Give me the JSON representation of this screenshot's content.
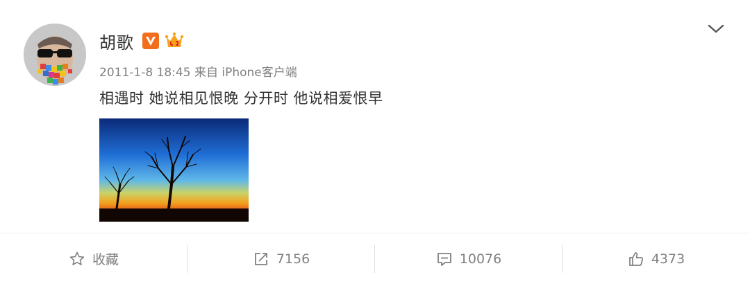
{
  "post": {
    "author": "胡歌",
    "meta": "2011-1-8 18:45 来自 iPhone客户端",
    "text": "相遇时 她说相见恨晚 分开时 他说相爱恨早"
  },
  "actions": [
    {
      "icon": "star-icon",
      "label": "收藏"
    },
    {
      "icon": "repost-icon",
      "label": "7156"
    },
    {
      "icon": "comment-icon",
      "label": "10076"
    },
    {
      "icon": "thumbs-up-icon",
      "label": "4373"
    }
  ],
  "colors": {
    "accent": "#f7a21b",
    "verified": "#f26d1c",
    "muted": "#808080"
  }
}
